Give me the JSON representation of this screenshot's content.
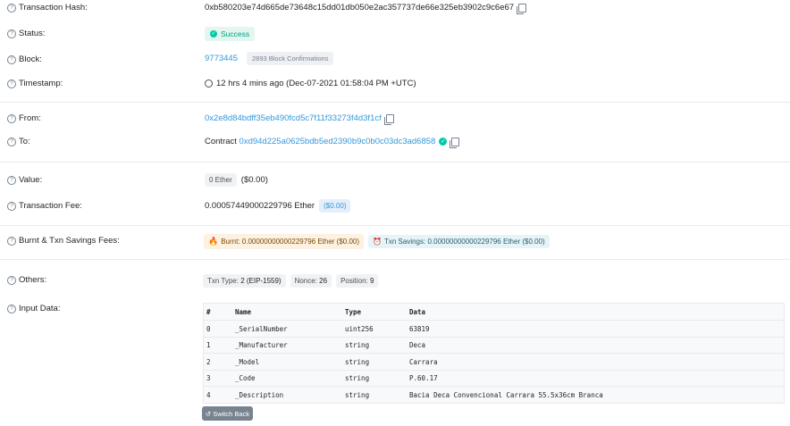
{
  "tx_hash": {
    "label": "Transaction Hash:",
    "value": "0xb580203e74d665de73648c15dd01db050e2ac357737de66e325eb3902c9c6e67"
  },
  "status": {
    "label": "Status:",
    "value": "Success"
  },
  "block": {
    "label": "Block:",
    "number": "9773445",
    "confirmations": "2893 Block Confirmations"
  },
  "timestamp": {
    "label": "Timestamp:",
    "value": "12 hrs 4 mins ago (Dec-07-2021 01:58:04 PM +UTC)"
  },
  "from": {
    "label": "From:",
    "value": "0x2e8d84bdff35eb490fcd5c7f11f33273f4d3f1cf"
  },
  "to": {
    "label": "To:",
    "prefix": "Contract",
    "value": "0xd94d225a0625bdb5ed2390b9c0b0c03dc3ad6858"
  },
  "value": {
    "label": "Value:",
    "badge": "0 Ether",
    "usd": "($0.00)"
  },
  "fee": {
    "label": "Transaction Fee:",
    "value": "0.00057449000229796 Ether",
    "usd": "($0.00)"
  },
  "burnt": {
    "label": "Burnt & Txn Savings Fees:",
    "burnt": "Burnt: 0.00000000000229796 Ether ($0.00)",
    "savings": "Txn Savings: 0.00000000000229796 Ether ($0.00)"
  },
  "others": {
    "label": "Others:",
    "txtype_key": "Txn Type:",
    "txtype_val": "2 (EIP-1559)",
    "nonce_key": "Nonce:",
    "nonce_val": "26",
    "position_key": "Position:",
    "position_val": "9"
  },
  "input": {
    "label": "Input Data:",
    "headers": [
      "#",
      "Name",
      "Type",
      "Data"
    ],
    "rows": [
      [
        "0",
        "_SerialNumber",
        "uint256",
        "63819"
      ],
      [
        "1",
        "_Manufacturer",
        "string",
        "Deca"
      ],
      [
        "2",
        "_Model",
        "string",
        "Carrara"
      ],
      [
        "3",
        "_Code",
        "string",
        "P.60.17"
      ],
      [
        "4",
        "_Description",
        "string",
        "Bacia Deca Convencional Carrara 55.5x36cm Branca"
      ]
    ],
    "switch_label": "Switch Back"
  }
}
